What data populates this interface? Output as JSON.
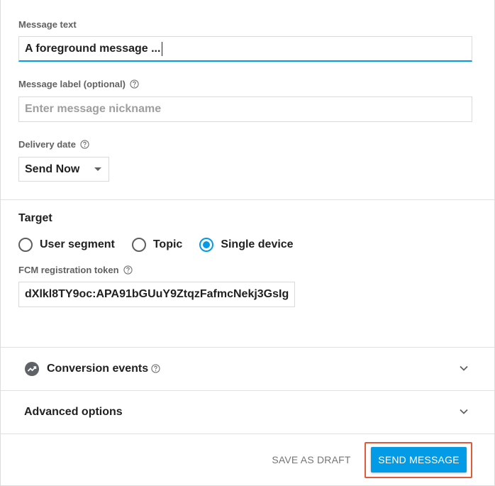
{
  "message_text": {
    "label": "Message text",
    "value": "A foreground message ..."
  },
  "message_label": {
    "label": "Message label (optional)",
    "placeholder": "Enter message nickname"
  },
  "delivery_date": {
    "label": "Delivery date",
    "selected": "Send Now"
  },
  "target": {
    "title": "Target",
    "options": [
      "User segment",
      "Topic",
      "Single device"
    ],
    "selected_index": 2,
    "token_label": "FCM registration token",
    "token_value": "dXlkl8TY9oc:APA91bGUuY9ZtqzFafmcNekj3GsIg"
  },
  "sections": {
    "conversion_events": "Conversion events",
    "advanced_options": "Advanced options"
  },
  "footer": {
    "save_draft": "SAVE AS DRAFT",
    "send_message": "SEND MESSAGE"
  },
  "colors": {
    "accent": "#039be5",
    "highlight": "#e25a3a"
  }
}
